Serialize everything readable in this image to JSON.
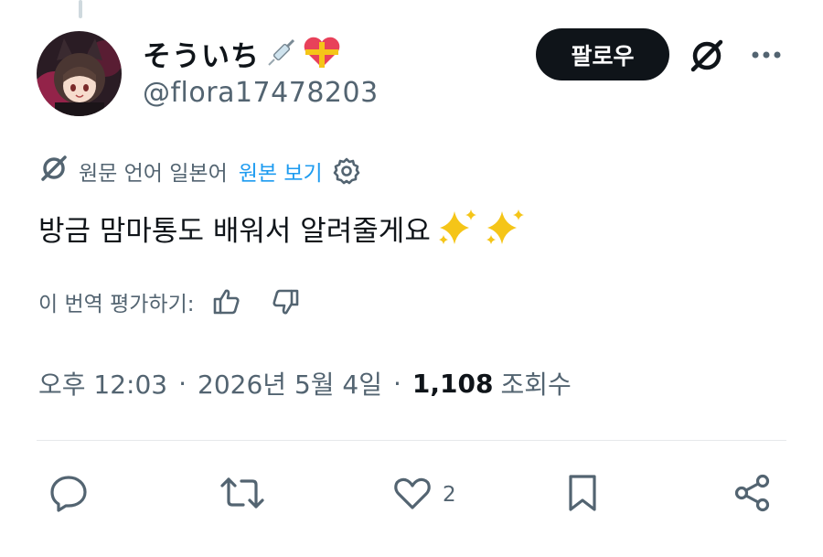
{
  "user": {
    "display_name": "そういち",
    "handle": "@flora17478203"
  },
  "follow_label": "팔로우",
  "translation": {
    "source_text": "원문 언어 일본어",
    "show_original": "원본 보기"
  },
  "tweet": {
    "text": "방금 맘마통도 배워서 알려줄게요",
    "emoji": "✨✨"
  },
  "rate": {
    "label": "이 번역 평가하기:"
  },
  "meta": {
    "time": "오후 12:03",
    "date": "2026년 5월 4일",
    "views_count": "1,108",
    "views_label": "조회수"
  },
  "actions": {
    "likes_count": "2"
  },
  "colors": {
    "text": "#0f1419",
    "secondary": "#536471",
    "link": "#1d9bf0",
    "button_bg": "#0f1419",
    "sparkle": "#f5c518"
  }
}
